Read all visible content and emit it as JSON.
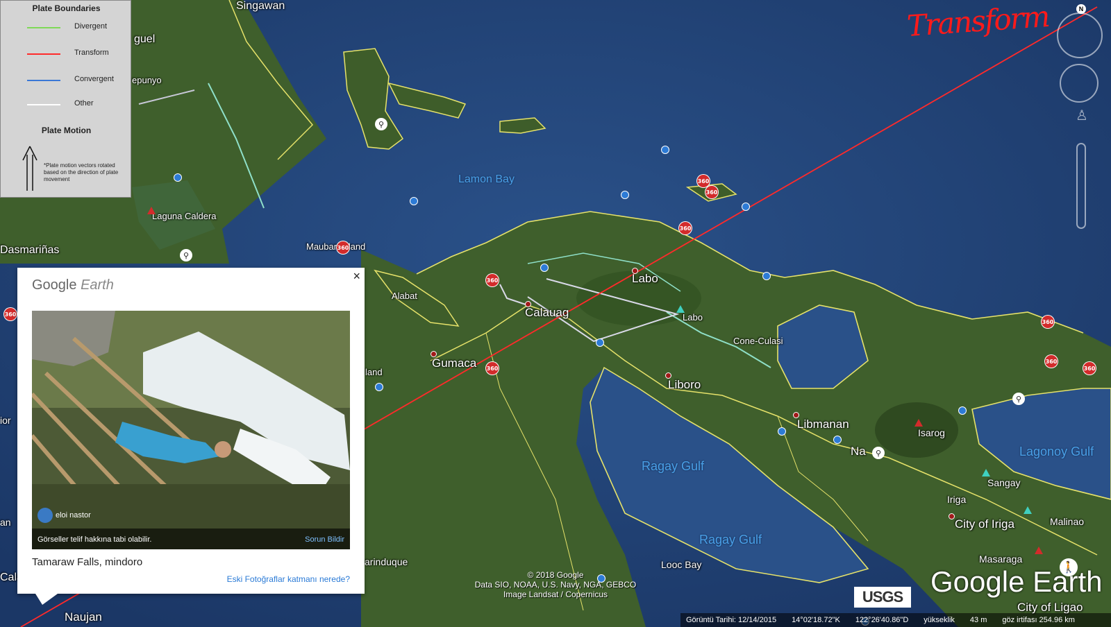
{
  "legend": {
    "boundaries_title": "Plate Boundaries",
    "items": [
      {
        "label": "Divergent",
        "color": "#7ed957"
      },
      {
        "label": "Transform",
        "color": "#ff2a2a"
      },
      {
        "label": "Convergent",
        "color": "#3a78d6"
      },
      {
        "label": "Other",
        "color": "#ffffff"
      }
    ],
    "motion_title": "Plate Motion",
    "note": "*Plate motion vectors rotated based on the direction of plate movement"
  },
  "annotation": "Transform",
  "places": [
    {
      "name": "Singawan"
    },
    {
      "name": "guel"
    },
    {
      "name": "epunyo"
    },
    {
      "name": "Laguna Caldera"
    },
    {
      "name": "Dasmariñas"
    },
    {
      "name": "Mauban Island"
    },
    {
      "name": "Alabat"
    },
    {
      "name": "Labo"
    },
    {
      "name": "Calauag"
    },
    {
      "name": "Labo"
    },
    {
      "name": "Cone-Culasi"
    },
    {
      "name": "Gumaca"
    },
    {
      "name": "Liboro"
    },
    {
      "name": "Libmanan"
    },
    {
      "name": "Isarog"
    },
    {
      "name": "Na"
    },
    {
      "name": "Sangay"
    },
    {
      "name": "Iriga"
    },
    {
      "name": "City of Iriga"
    },
    {
      "name": "Malinao"
    },
    {
      "name": "Masaraga"
    },
    {
      "name": "City of Ligao"
    },
    {
      "name": "Naujan"
    },
    {
      "name": "arinduque"
    },
    {
      "name": "land"
    },
    {
      "name": "Cala"
    },
    {
      "name": "an"
    },
    {
      "name": "ior"
    }
  ],
  "water_bodies": [
    {
      "name": "Lamon Bay"
    },
    {
      "name": "Ragay Gulf"
    },
    {
      "name": "Ragay Gulf"
    },
    {
      "name": "Lagonoy Gulf"
    },
    {
      "name": "Looc Bay"
    }
  ],
  "popup": {
    "brand": "Google",
    "brand_italic": "Earth",
    "close": "×",
    "user": "eloi nastor",
    "copyright": "Görseller telif hakkına tabi olabilir.",
    "report": "Sorun Bildir",
    "title": "Tamaraw Falls, mindoro",
    "link": "Eski Fotoğraflar katmanı nerede?"
  },
  "attribution": {
    "line1": "© 2018 Google",
    "line2": "Data SIO, NOAA, U.S. Navy, NGA, GEBCO",
    "line3": "Image Landsat / Copernicus"
  },
  "usgs": "USGS",
  "logo": "Google Earth",
  "status": {
    "date": "Görüntü Tarihi: 12/14/2015",
    "lat": "14°02'18.72\"K",
    "lon": "122°26'40.86\"D",
    "elev_label": "yükseklik",
    "elev": "43 m",
    "eye": "göz irtifası 254.96 km"
  },
  "compass_n": "N",
  "marker_360": "360"
}
